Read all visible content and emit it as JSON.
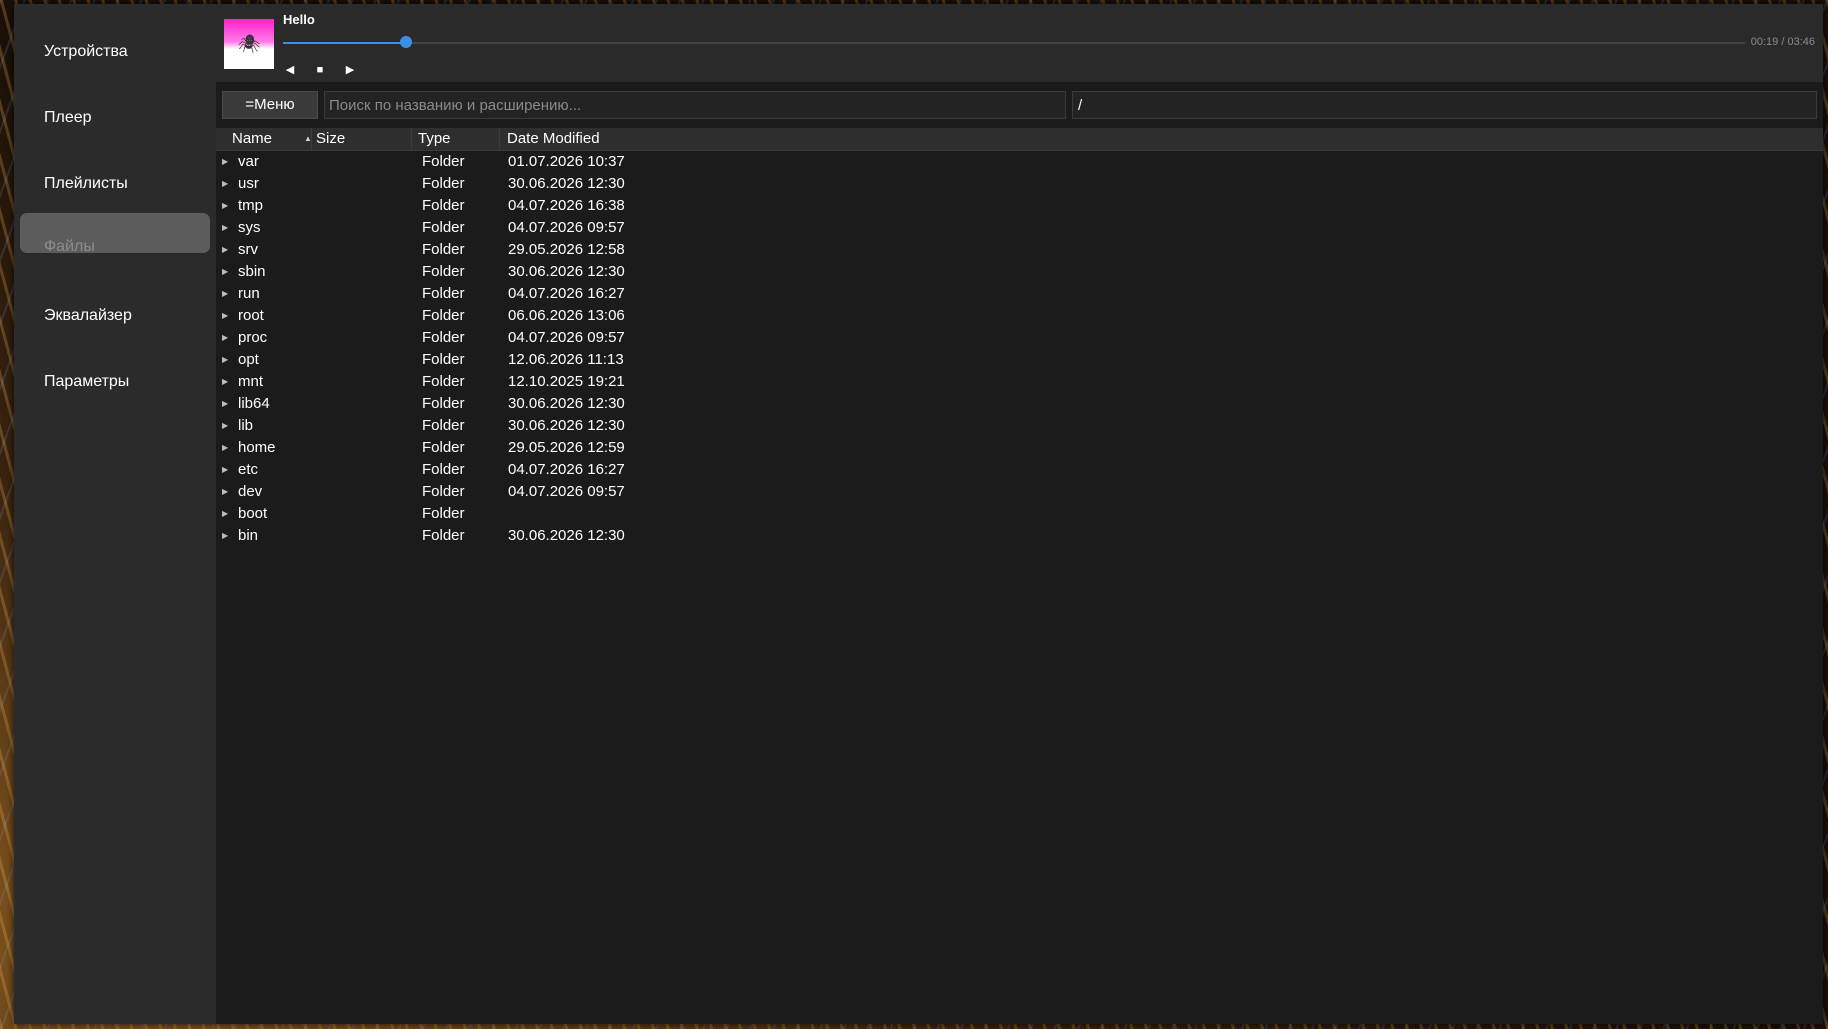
{
  "sidebar": {
    "items": [
      {
        "label": "Устройства",
        "active": false
      },
      {
        "label": "Плеер",
        "active": false
      },
      {
        "label": "Плейлисты",
        "active": false
      },
      {
        "label": "Файлы",
        "active": true
      },
      {
        "label": "Эквалайзер",
        "active": false
      },
      {
        "label": "Параметры",
        "active": false
      }
    ]
  },
  "player": {
    "title": "Hello",
    "time": "00:19 / 03:46",
    "progress_fraction": 0.084,
    "accent_color": "#3a8fe6",
    "controls": {
      "prev_icon": "◀",
      "stop_icon": "■",
      "next_icon": "▶"
    }
  },
  "toolbar": {
    "menu_label": "=Меню",
    "search_placeholder": "Поиск по названию и расширению...",
    "search_value": "",
    "path_value": "/"
  },
  "table": {
    "columns": {
      "name": "Name",
      "size": "Size",
      "type": "Type",
      "date": "Date Modified"
    },
    "sort_column": "name",
    "rows": [
      {
        "name": "var",
        "size": "",
        "type": "Folder",
        "date": "01.07.2026 10:37"
      },
      {
        "name": "usr",
        "size": "",
        "type": "Folder",
        "date": "30.06.2026 12:30"
      },
      {
        "name": "tmp",
        "size": "",
        "type": "Folder",
        "date": "04.07.2026 16:38"
      },
      {
        "name": "sys",
        "size": "",
        "type": "Folder",
        "date": "04.07.2026 09:57"
      },
      {
        "name": "srv",
        "size": "",
        "type": "Folder",
        "date": "29.05.2026 12:58"
      },
      {
        "name": "sbin",
        "size": "",
        "type": "Folder",
        "date": "30.06.2026 12:30"
      },
      {
        "name": "run",
        "size": "",
        "type": "Folder",
        "date": "04.07.2026 16:27"
      },
      {
        "name": "root",
        "size": "",
        "type": "Folder",
        "date": "06.06.2026 13:06"
      },
      {
        "name": "proc",
        "size": "",
        "type": "Folder",
        "date": "04.07.2026 09:57"
      },
      {
        "name": "opt",
        "size": "",
        "type": "Folder",
        "date": "12.06.2026 11:13"
      },
      {
        "name": "mnt",
        "size": "",
        "type": "Folder",
        "date": "12.10.2025 19:21"
      },
      {
        "name": "lib64",
        "size": "",
        "type": "Folder",
        "date": "30.06.2026 12:30"
      },
      {
        "name": "lib",
        "size": "",
        "type": "Folder",
        "date": "30.06.2026 12:30"
      },
      {
        "name": "home",
        "size": "",
        "type": "Folder",
        "date": "29.05.2026 12:59"
      },
      {
        "name": "etc",
        "size": "",
        "type": "Folder",
        "date": "04.07.2026 16:27"
      },
      {
        "name": "dev",
        "size": "",
        "type": "Folder",
        "date": "04.07.2026 09:57"
      },
      {
        "name": "boot",
        "size": "",
        "type": "Folder",
        "date": ""
      },
      {
        "name": "bin",
        "size": "",
        "type": "Folder",
        "date": "30.06.2026 12:30"
      }
    ]
  }
}
